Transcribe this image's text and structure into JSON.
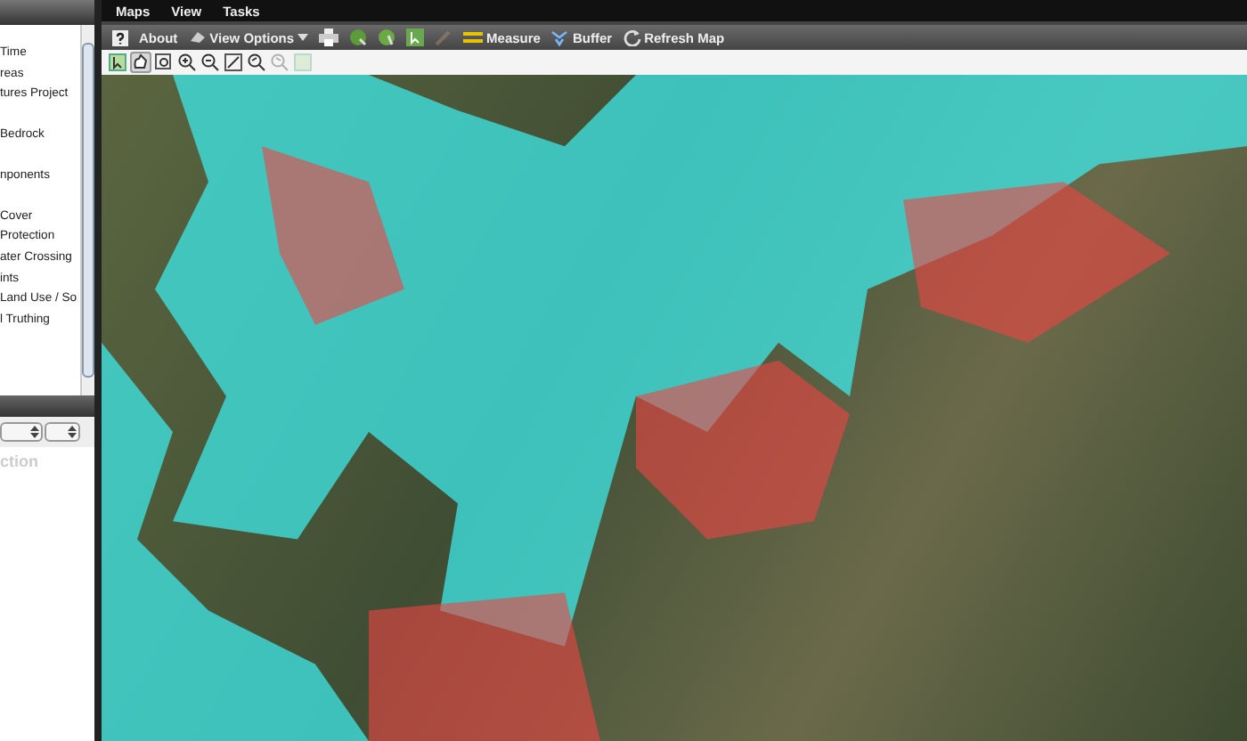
{
  "menu": [
    "Maps",
    "View",
    "Tasks"
  ],
  "layers_panel": {
    "items": [
      {
        "label": "Time"
      },
      {
        "label": "reas"
      },
      {
        "label": "tures Project"
      },
      {
        "label": "Bedrock"
      },
      {
        "label": "nponents"
      },
      {
        "label": "Cover"
      },
      {
        "label": "Protection"
      },
      {
        "label": "ater Crossing"
      },
      {
        "label": "ints"
      },
      {
        "label": "Land Use / So"
      },
      {
        "label": "l Truthing"
      }
    ]
  },
  "lower_panel": {
    "heading": "ction"
  },
  "toolbar": {
    "about": "About",
    "view_options": "View Options",
    "measure": "Measure",
    "buffer": "Buffer",
    "refresh": "Refresh Map",
    "paint_disabled": true
  },
  "tools": [
    {
      "kind": "select",
      "selected": false,
      "disabled": false
    },
    {
      "kind": "pan",
      "selected": true,
      "disabled": false
    },
    {
      "kind": "zoom-box",
      "selected": false,
      "disabled": false
    },
    {
      "kind": "zoom-in",
      "selected": false,
      "disabled": false
    },
    {
      "kind": "zoom-out",
      "selected": false,
      "disabled": false
    },
    {
      "kind": "full-extent",
      "selected": false,
      "disabled": false
    },
    {
      "kind": "zoom-previous",
      "selected": false,
      "disabled": false
    },
    {
      "kind": "zoom-next",
      "selected": false,
      "disabled": true
    },
    {
      "kind": "identify",
      "selected": false,
      "disabled": true
    }
  ]
}
